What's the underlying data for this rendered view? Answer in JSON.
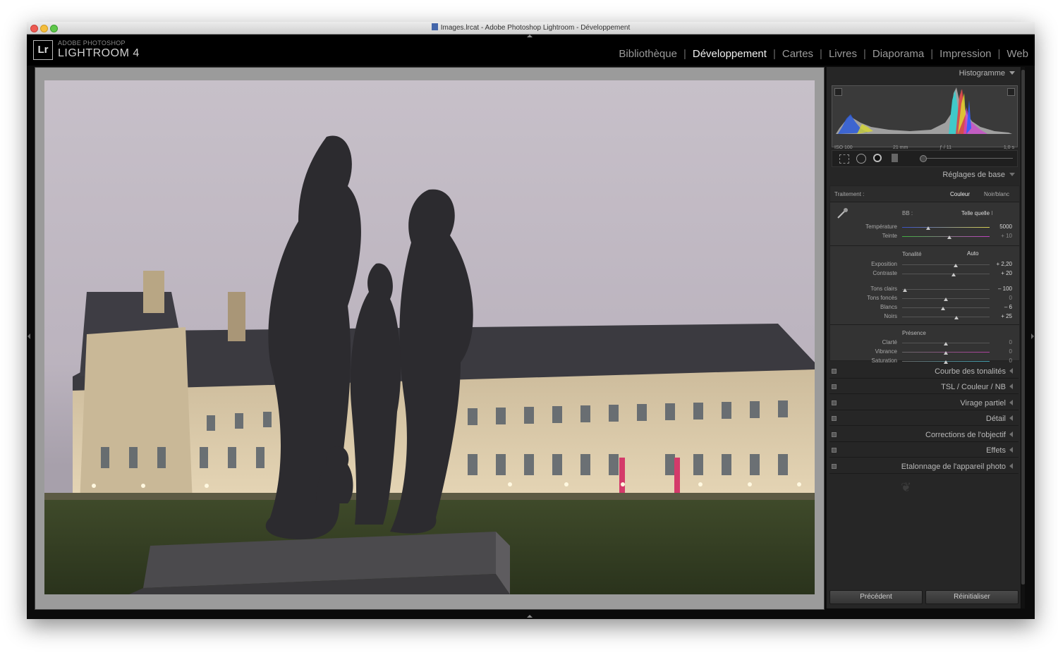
{
  "window": {
    "title": "Images.lrcat - Adobe Photoshop Lightroom - Développement"
  },
  "app": {
    "subtitle": "ADOBE PHOTOSHOP",
    "name": "LIGHTROOM 4",
    "badge": "Lr"
  },
  "modules": [
    {
      "label": "Bibliothèque",
      "active": false
    },
    {
      "label": "Développement",
      "active": true
    },
    {
      "label": "Cartes",
      "active": false
    },
    {
      "label": "Livres",
      "active": false
    },
    {
      "label": "Diaporama",
      "active": false
    },
    {
      "label": "Impression",
      "active": false
    },
    {
      "label": "Web",
      "active": false
    }
  ],
  "histogram": {
    "title": "Histogramme",
    "iso": "ISO 100",
    "focal": "21 mm",
    "aperture": "ƒ / 11",
    "shutter": "1,0 s"
  },
  "basic": {
    "title": "Réglages de base",
    "treatment_label": "Traitement :",
    "treatment_color": "Couleur",
    "treatment_bw": "Noir/blanc",
    "wb_label": "BB :",
    "wb_value": "Telle quelle",
    "temperature": {
      "label": "Température",
      "value": "5000",
      "pos": 0.3
    },
    "tint": {
      "label": "Teinte",
      "value": "+ 10",
      "pos": 0.54
    },
    "tone_title": "Tonalité",
    "auto": "Auto",
    "exposure": {
      "label": "Exposition",
      "value": "+ 2,20",
      "pos": 0.61
    },
    "contrast": {
      "label": "Contraste",
      "value": "+ 20",
      "pos": 0.59
    },
    "highlights": {
      "label": "Tons clairs",
      "value": "– 100",
      "pos": 0.03
    },
    "shadows": {
      "label": "Tons foncés",
      "value": "0",
      "pos": 0.5
    },
    "whites": {
      "label": "Blancs",
      "value": "– 6",
      "pos": 0.47
    },
    "blacks": {
      "label": "Noirs",
      "value": "+ 25",
      "pos": 0.62
    },
    "presence_title": "Présence",
    "clarity": {
      "label": "Clarté",
      "value": "0",
      "pos": 0.5
    },
    "vibrance": {
      "label": "Vibrance",
      "value": "0",
      "pos": 0.5
    },
    "saturation": {
      "label": "Saturation",
      "value": "0",
      "pos": 0.5
    }
  },
  "panels": [
    "Courbe des tonalités",
    "TSL  /  Couleur  /  NB",
    "Virage partiel",
    "Détail",
    "Corrections de l'objectif",
    "Effets",
    "Etalonnage de l'appareil photo"
  ],
  "buttons": {
    "previous": "Précédent",
    "reset": "Réinitialiser"
  },
  "colors": {
    "accent": "#f0f0f0",
    "panel": "#262626",
    "background": "#0b0b0b"
  }
}
